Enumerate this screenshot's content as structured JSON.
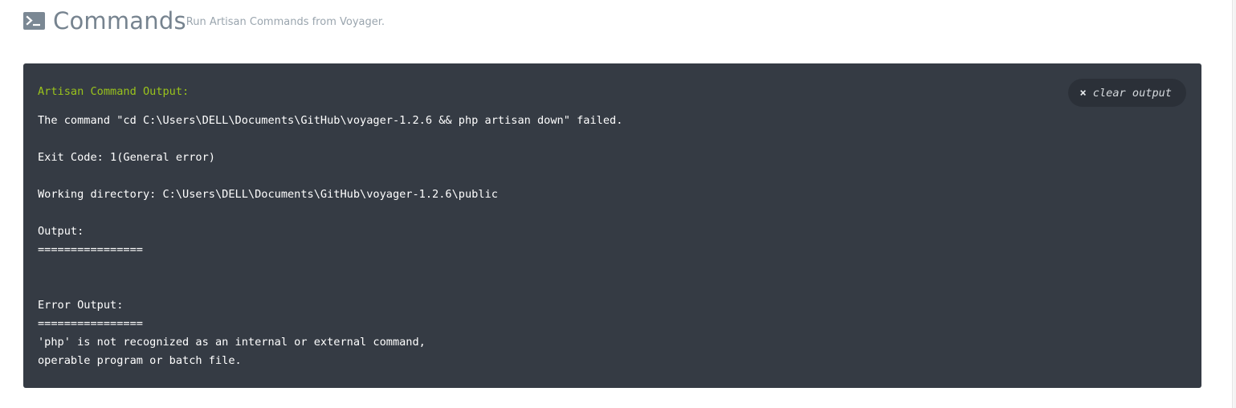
{
  "header": {
    "title": "Commands",
    "subtitle": "Run Artisan Commands from Voyager.",
    "icon": "terminal-icon"
  },
  "terminal": {
    "heading": "Artisan Command Output:",
    "clear_button": {
      "icon": "close-icon",
      "icon_glyph": "×",
      "label": "clear output"
    },
    "lines": [
      "The command \"cd C:\\Users\\DELL\\Documents\\GitHub\\voyager-1.2.6 && php artisan down\" failed.",
      "",
      "Exit Code: 1(General error)",
      "",
      "Working directory: C:\\Users\\DELL\\Documents\\GitHub\\voyager-1.2.6\\public",
      "",
      "Output:",
      "================",
      "",
      "",
      "Error Output:",
      "================",
      "'php' is not recognized as an internal or external command,",
      "operable program or batch file."
    ]
  },
  "colors": {
    "terminal_background": "#353b44",
    "heading_green": "#9ac31c",
    "title_gray": "#76838f"
  }
}
